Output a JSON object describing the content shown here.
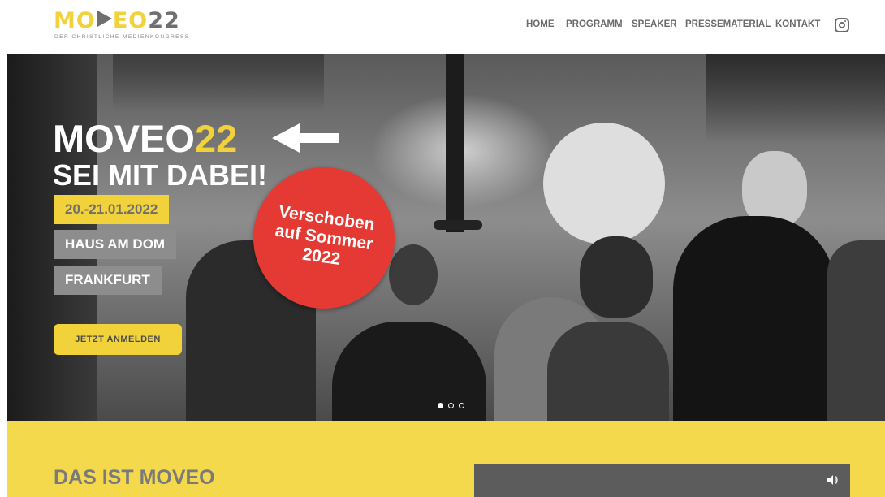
{
  "header": {
    "logo": {
      "part1": "MO",
      "part2": "EO",
      "part3": "22",
      "tagline": "DER CHRISTLICHE MEDIENKONGRESS"
    },
    "nav": [
      {
        "label": "HOME"
      },
      {
        "label": "PROGRAMM"
      },
      {
        "label": "SPEAKER"
      },
      {
        "label": "PRESSEMATERIAL"
      },
      {
        "label": "KONTAKT"
      }
    ],
    "social_icon": "instagram-icon"
  },
  "hero": {
    "title_main": "MOVEO",
    "title_accent": "22",
    "subtitle": "SEI MIT DABEI!",
    "date": "20.-21.01.2022",
    "venue": "HAUS AM DOM",
    "city": "FRANKFURT",
    "cta_label": "JETZT ANMELDEN",
    "badge": {
      "line1": "Verschoben",
      "line2": "auf Sommer",
      "line3": "2022"
    },
    "slider": {
      "count": 3,
      "active": 1
    }
  },
  "intro": {
    "heading": "DAS IST MOVEO"
  },
  "colors": {
    "accent_yellow": "#f2d23a",
    "section_yellow": "#f5d94d",
    "badge_red": "#e53a34",
    "text_gray": "#6a6a6a",
    "tag_gray": "#8d8d8d"
  }
}
